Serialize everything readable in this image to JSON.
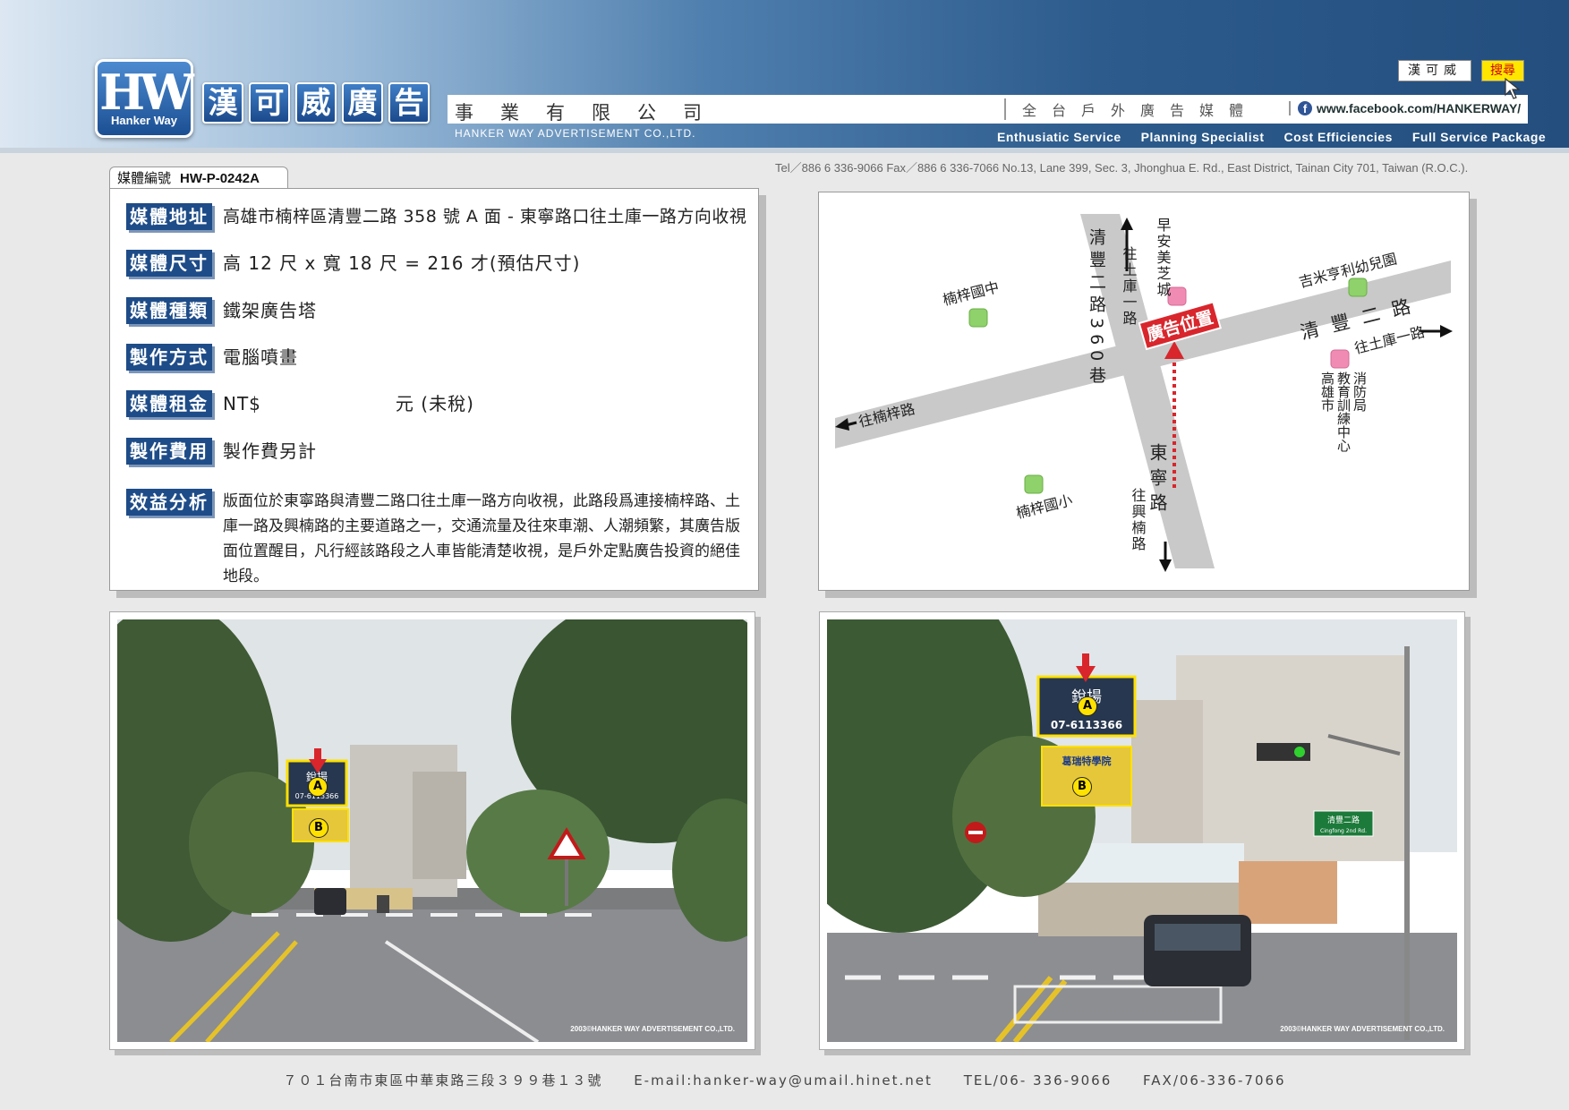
{
  "header": {
    "logo_text": "HW",
    "logo_subtext": "Hanker Way",
    "brand_chars": [
      "漢",
      "可",
      "威",
      "廣",
      "告"
    ],
    "company_suffix": "事業有限公司",
    "company_en": "HANKER WAY ADVERTISEMENT CO.,LTD.",
    "tagline": "全台戶外廣告媒體",
    "facebook_url": "www.facebook.com/HANKERWAY/",
    "company_button": "漢可威",
    "search_button": "搜尋",
    "services": [
      "Enthusiatic Service",
      "Planning Specialist",
      "Cost Efficiencies",
      "Full Service Package"
    ],
    "contact_line": "Tel／886 6 336-9066   Fax／886 6 336-7066   No.13, Lane 399, Sec. 3, Jhonghua E. Rd., East District, Tainan City 701, Taiwan (R.O.C.)."
  },
  "media": {
    "id_label": "媒體編號",
    "id_value": "HW-P-0242A",
    "rows": [
      {
        "label": "媒體地址",
        "value": "高雄市楠梓區清豐二路 358 號 A 面 - 東寧路口往土庫一路方向收視"
      },
      {
        "label": "媒體尺寸",
        "value": "高 12 尺 x 寬 18 尺 = 216 才(預估尺寸)"
      },
      {
        "label": "媒體種類",
        "value": "鐵架廣告塔"
      },
      {
        "label": "製作方式",
        "value": "電腦噴畫"
      },
      {
        "label": "媒體租金",
        "value": "NT$",
        "unit": "元 (未稅)"
      },
      {
        "label": "製作費用",
        "value": "製作費另計"
      },
      {
        "label": "效益分析",
        "value": "版面位於東寧路與清豐二路口往土庫一路方向收視，此路段爲連接楠梓路、土庫一路及興楠路的主要道路之一，交通流量及往來車潮、人潮頻繁，其廣告版面位置醒目，凡行經該路段之人車皆能清楚收視，是戶外定點廣告投資的絕佳地段。"
      }
    ]
  },
  "map": {
    "road_vertical_north": "清豐二路360巷",
    "to_tuku_north": "往土庫一路",
    "zaoan": "早安美芝城",
    "nanzi_junior_high": "楠梓國中",
    "kindergarten": "吉米亨利幼兒園",
    "road_main": "清豐二路",
    "to_tuku_east": "往土庫一路",
    "ad_location": "廣告位置",
    "to_nanzi_road": "往楠梓路",
    "education_bureau_col1": "高雄市",
    "education_bureau_col2": "教育訓練中心",
    "education_bureau_col3": "消防局",
    "dongning_road": "東寧路",
    "to_xingnan_road": "往興楠路",
    "nanzi_elementary": "楠梓國小"
  },
  "photos": {
    "copyright": "2003©HANKER WAY ADVERTISEMENT CO.,LTD.",
    "marker_a": "A",
    "marker_b": "B",
    "billboard_a_title": "銳揚",
    "billboard_a_phone": "07-6113366",
    "billboard_b_title": "葛瑞特學院",
    "street_sign_cn": "清豐二路",
    "street_sign_en": "Cingfong 2nd Rd."
  },
  "footer": {
    "address": "７０１台南市東區中華東路三段３９９巷１３號",
    "email": "E-mail:hanker-way@umail.hinet.net",
    "tel": "TEL/06- 336-9066",
    "fax": "FAX/06-336-7066"
  },
  "colors": {
    "brand_blue": "#1e4c88",
    "ad_marker_red": "#d8262c",
    "poi_green": "#8fd16a",
    "poi_pink": "#f08cb4",
    "road_gray": "#c9c9c9"
  }
}
